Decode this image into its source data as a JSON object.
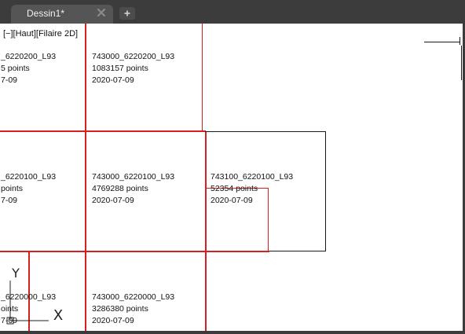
{
  "tabs": [
    {
      "label": "Dessin1*",
      "active": true
    }
  ],
  "new_tab_icon": "plus-icon",
  "viewport": {
    "controls": {
      "minimize": "[−]",
      "view": "[Haut]",
      "style": "[Filaire 2D]"
    }
  },
  "tiles": [
    {
      "id": "t1",
      "name": "_6220200_L93",
      "points": "5 points",
      "date": "7-09"
    },
    {
      "id": "t2",
      "name": "743000_6220200_L93",
      "points": "1083157 points",
      "date": "2020-07-09"
    },
    {
      "id": "t3",
      "name": "_6220100_L93",
      "points": " points",
      "date": "7-09"
    },
    {
      "id": "t4",
      "name": "743000_6220100_L93",
      "points": "4769288 points",
      "date": "2020-07-09"
    },
    {
      "id": "t5",
      "name": "743100_6220100_L93",
      "points": "52354 points",
      "date": "2020-07-09"
    },
    {
      "id": "t6",
      "name": "_6220000_L93",
      "points": "oints",
      "date": "7-09"
    },
    {
      "id": "t7",
      "name": "743000_6220000_L93",
      "points": "3286380 points",
      "date": "2020-07-09"
    }
  ],
  "ucs": {
    "x_label": "X",
    "y_label": "Y"
  },
  "colors": {
    "tile_border": "#d62020",
    "frame": "#1a1a1a",
    "background": "#ffffff",
    "chrome": "#3b3b3b",
    "tab": "#555555"
  }
}
